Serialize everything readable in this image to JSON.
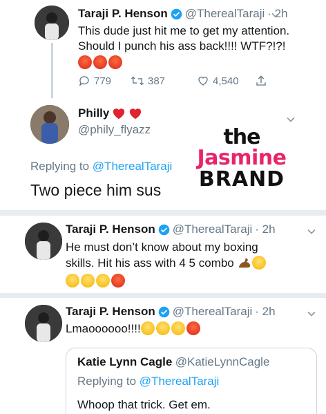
{
  "tweets": [
    {
      "name": "Taraji P. Henson",
      "handle": "@TherealTaraji",
      "time": "· 2h",
      "text_line1": "This dude just hit me to get my attention.",
      "text_line2": "Should I punch his ass back!!!! WTF?!?!",
      "emojis": [
        "angry-face-emoji",
        "angry-face-emoji",
        "angry-face-emoji"
      ],
      "replies": "779",
      "retweets": "387",
      "likes": "4,540"
    },
    {
      "name": "Philly",
      "name_emojis": [
        "red-heart-emoji",
        "red-heart-emoji"
      ],
      "handle": "@phily_flyazz",
      "replying_prefix": "Replying to",
      "replying_mention": "@TherealTaraji",
      "text": "Two piece him sus"
    },
    {
      "name": "Taraji P. Henson",
      "handle": "@TherealTaraji",
      "time": "· 2h",
      "text_line1": "He must don’t know about my boxing",
      "text_line2": "skills. Hit his ass with 4 5 combo",
      "emojis_line2": [
        "flexed-biceps-emoji",
        "weary-face-emoji"
      ],
      "emojis_line3": [
        "laughing-tears-emoji",
        "laughing-tears-emoji",
        "laughing-tears-emoji",
        "angry-face-emoji"
      ]
    },
    {
      "name": "Taraji P. Henson",
      "handle": "@TherealTaraji",
      "time": "· 2h",
      "text": "Lmaoooooo!!!!",
      "emojis": [
        "laughing-tears-emoji",
        "laughing-tears-emoji",
        "laughing-tears-emoji",
        "angry-face-emoji"
      ],
      "quote": {
        "name": "Katie Lynn Cagle",
        "handle": "@KatieLynnCagle",
        "replying_prefix": "Replying to",
        "replying_mention": "@TherealTaraji",
        "text": "Whoop that trick. Get em."
      }
    }
  ],
  "watermark": {
    "line1": "the",
    "line2": "Jasmine",
    "line3": "BRAND"
  },
  "colors": {
    "link": "#1da1f2",
    "muted": "#657786",
    "verified": "#1da1f2",
    "watermark_pink": "#e8246a"
  }
}
